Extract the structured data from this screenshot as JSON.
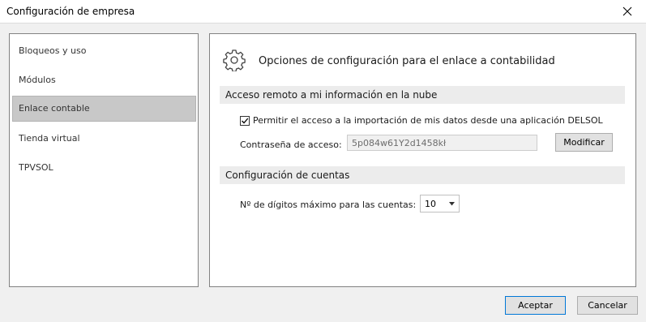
{
  "window": {
    "title": "Configuración de empresa"
  },
  "sidebar": {
    "items": [
      {
        "label": "Bloqueos y uso"
      },
      {
        "label": "Módulos"
      },
      {
        "label": "Enlace contable"
      },
      {
        "label": "Tienda virtual"
      },
      {
        "label": "TPVSOL"
      }
    ],
    "selected": "Enlace contable"
  },
  "main": {
    "header": {
      "title": "Opciones de configuración para el enlace a contabilidad",
      "icon": "gear-icon"
    },
    "remote_section": {
      "title": "Acceso remoto a mi información en la nube",
      "checkbox_label": "Permitir el acceso a la importación de mis datos desde una aplicación DELSOL",
      "checkbox_checked": true,
      "password_label": "Contraseña de acceso:",
      "password_value": "5p084w61Y2d1458kł",
      "modify_label": "Modificar"
    },
    "accounts_section": {
      "title": "Configuración de cuentas",
      "digits_label": "Nº de dígitos máximo para las cuentas:",
      "digits_value": "10"
    }
  },
  "footer": {
    "accept_label": "Aceptar",
    "cancel_label": "Cancelar"
  }
}
